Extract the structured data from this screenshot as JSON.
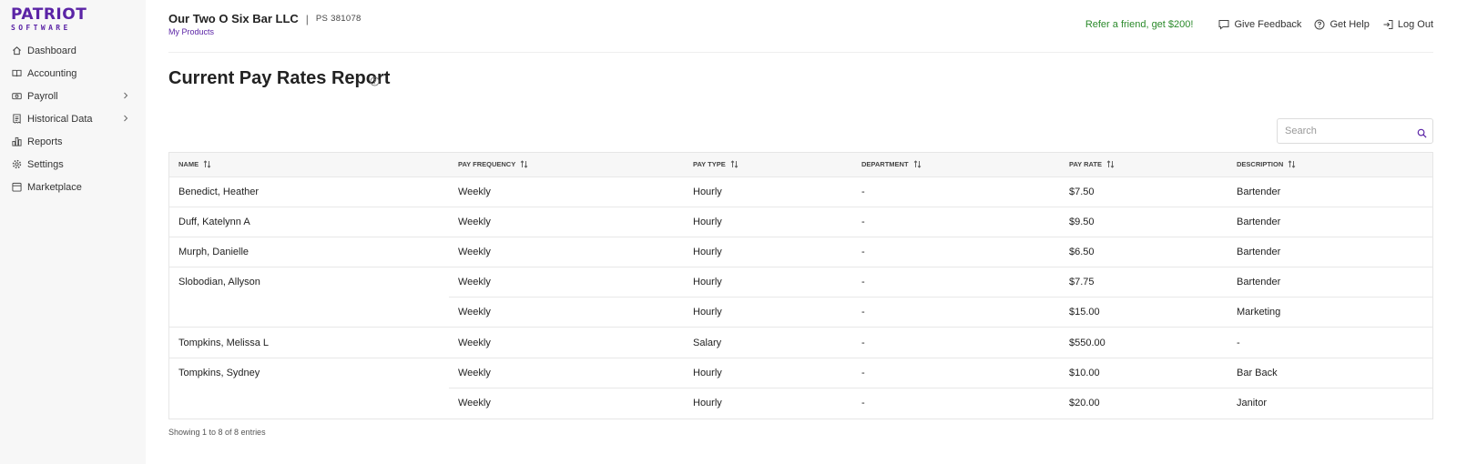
{
  "brand": {
    "name": "PATRIOT",
    "sub": "SOFTWARE",
    "color": "#5b24a6"
  },
  "sidebar": {
    "items": [
      {
        "label": "Dashboard",
        "icon": "home-icon",
        "has_chevron": false
      },
      {
        "label": "Accounting",
        "icon": "book-icon",
        "has_chevron": false
      },
      {
        "label": "Payroll",
        "icon": "money-icon",
        "has_chevron": true
      },
      {
        "label": "Historical Data",
        "icon": "receipt-icon",
        "has_chevron": true
      },
      {
        "label": "Reports",
        "icon": "bar-chart-icon",
        "has_chevron": false
      },
      {
        "label": "Settings",
        "icon": "gear-icon",
        "has_chevron": false
      },
      {
        "label": "Marketplace",
        "icon": "store-icon",
        "has_chevron": false
      }
    ]
  },
  "header": {
    "company": "Our Two O Six Bar LLC",
    "divider": "|",
    "ps_id": "PS 381078",
    "my_products": "My Products",
    "refer": "Refer a friend, get $200!",
    "feedback": "Give Feedback",
    "help": "Get Help",
    "logout": "Log Out",
    "refer_color": "#2b8a2b"
  },
  "page": {
    "title": "Current Pay Rates Report"
  },
  "search": {
    "placeholder": "Search",
    "value": ""
  },
  "table": {
    "columns": [
      "Name",
      "Pay Frequency",
      "Pay Type",
      "Department",
      "Pay Rate",
      "Description"
    ],
    "rows": [
      [
        "Benedict, Heather",
        "Weekly",
        "Hourly",
        "-",
        "$7.50",
        "Bartender"
      ],
      [
        "Duff, Katelynn A",
        "Weekly",
        "Hourly",
        "-",
        "$9.50",
        "Bartender"
      ],
      [
        "Murph, Danielle",
        "Weekly",
        "Hourly",
        "-",
        "$6.50",
        "Bartender"
      ],
      [
        "Slobodian, Allyson",
        "Weekly",
        "Hourly",
        "-",
        "$7.75",
        "Bartender"
      ],
      [
        "",
        "Weekly",
        "Hourly",
        "-",
        "$15.00",
        "Marketing"
      ],
      [
        "Tompkins, Melissa L",
        "Weekly",
        "Salary",
        "-",
        "$550.00",
        "-"
      ],
      [
        "Tompkins, Sydney",
        "Weekly",
        "Hourly",
        "-",
        "$10.00",
        "Bar Back"
      ],
      [
        "",
        "Weekly",
        "Hourly",
        "-",
        "$20.00",
        "Janitor"
      ]
    ]
  },
  "footer": {
    "showing": "Showing 1 to 8 of 8 entries"
  }
}
